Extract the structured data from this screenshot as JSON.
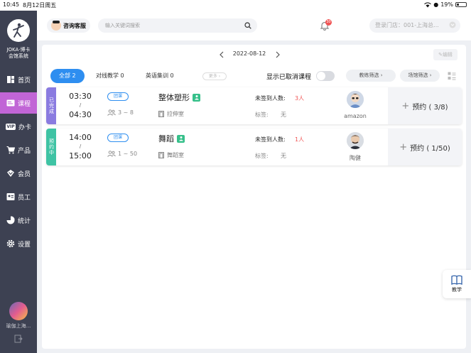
{
  "status_bar": {
    "time": "10:45",
    "date": "8月12日周五",
    "battery": "19%"
  },
  "sidebar": {
    "brand_line1": "JOKA·博卡",
    "brand_line2": "会馆系统",
    "items": [
      {
        "label": "首页",
        "icon": "home-icon"
      },
      {
        "label": "课程",
        "icon": "course-icon",
        "active": true
      },
      {
        "label": "办卡",
        "icon": "vip-icon"
      },
      {
        "label": "产品",
        "icon": "cart-icon"
      },
      {
        "label": "会员",
        "icon": "member-icon"
      },
      {
        "label": "员工",
        "icon": "staff-icon"
      },
      {
        "label": "统计",
        "icon": "stats-icon"
      },
      {
        "label": "设置",
        "icon": "settings-icon"
      }
    ],
    "vip_text": "VIP",
    "store_name": "瑜伽上海..."
  },
  "header": {
    "service_label": "咨询客服",
    "search_placeholder": "输入关键词搜索",
    "notification_count": "30",
    "store_select": "登录门店：001-上海总..."
  },
  "toolbar": {
    "date": "2022-08-12",
    "edit_label": "编辑",
    "tabs": [
      {
        "label": "全部 2",
        "active": true
      },
      {
        "label": "对线教学 0"
      },
      {
        "label": "英语集训 0"
      }
    ],
    "more_label": "更多 ›",
    "show_cancelled_label": "显示已取消课程",
    "coach_filter": "教练筛选 ›",
    "venue_filter": "场馆筛选 ›"
  },
  "courses": [
    {
      "status": "已完成",
      "status_color": "#8a7be0",
      "start": "03:30",
      "sep": "/",
      "end": "04:30",
      "type": "团课",
      "capacity": "3 ~ 8",
      "name": "整体塑形",
      "room": "拉伸室",
      "unsigned_label": "未签到人数:",
      "unsigned": "3人",
      "tags_label": "标签:",
      "tags": "无",
      "coach": "amazon",
      "booking": "预约 ( 3/8)"
    },
    {
      "status": "预约中",
      "status_color": "#3fc3a4",
      "start": "14:00",
      "sep": "/",
      "end": "15:00",
      "type": "团课",
      "capacity": "1 ~ 50",
      "name": "舞蹈",
      "room": "舞蹈室",
      "unsigned_label": "未签到人数:",
      "unsigned": "1人",
      "tags_label": "标签:",
      "tags": "无",
      "coach": "陶健",
      "booking": "预约 ( 1/50)"
    }
  ],
  "float_button": {
    "label": "教学"
  },
  "colors": {
    "accent": "#2e8ef0",
    "sidebar": "#3d4152",
    "active_nav": "#c165d6",
    "alert": "#f05454"
  }
}
